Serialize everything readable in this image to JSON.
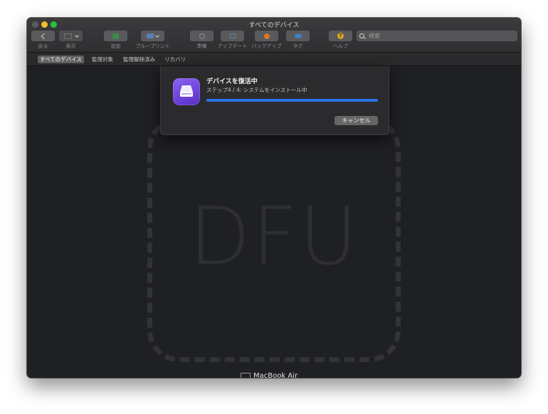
{
  "window": {
    "title": "すべてのデバイス"
  },
  "toolbar": {
    "back_label": "戻る",
    "view_label": "表示",
    "add_label": "追加",
    "blueprint_label": "ブループリント",
    "prepare_label": "準備",
    "update_label": "アップデート",
    "backup_label": "バックアップ",
    "tag_label": "タグ",
    "help_label": "ヘルプ"
  },
  "search": {
    "placeholder": "検索"
  },
  "filters": [
    {
      "label": "すべてのデバイス",
      "active": true
    },
    {
      "label": "監理対象"
    },
    {
      "label": "監理解除済み"
    },
    {
      "label": "リカバリ"
    }
  ],
  "sheet": {
    "title": "デバイスを復活中",
    "step": "ステップ4 / 4: システムをインストール中",
    "progress": 1.0,
    "cancel_label": "キャンセル"
  },
  "device": {
    "big_label": "DFU",
    "name": "MacBook Air"
  },
  "colors": {
    "accent": "#2a72e6",
    "app_icon": "#6c3fe0",
    "background": "#1f2024"
  }
}
